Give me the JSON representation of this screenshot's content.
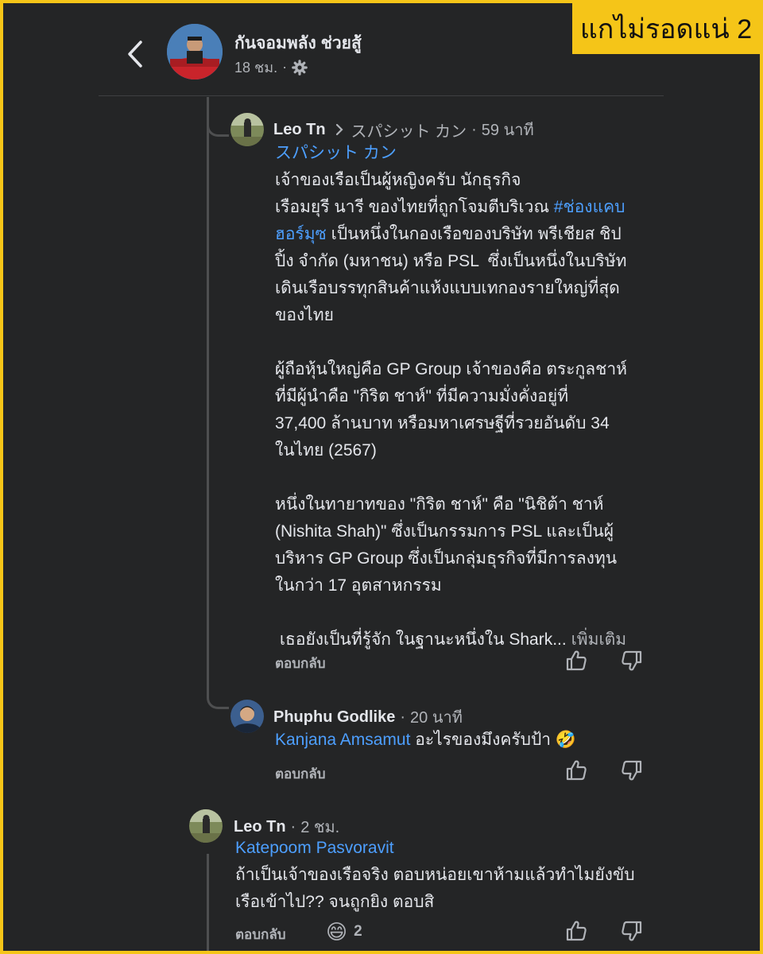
{
  "overlay_tag": "แกไม่รอดแน่ 2",
  "header": {
    "name": "กันจอมพลัง ช่วยสู้",
    "time": "18 ชม.",
    "separator": "·",
    "more": "···"
  },
  "comments": [
    {
      "author": "Leo Tn",
      "reply_to": "スパシット カン",
      "separator": "·",
      "time": "59 นาที",
      "mention": "スパシット カン",
      "body_pre": "เจ้าของเรือเป็นผู้หญิงครับ นักธุรกิจ\nเรือมยุรี นารี ของไทยที่ถูกโจมตีบริเวณ ",
      "hashtag": "#ช่องแคบ\nฮอร์มุซ",
      "body_post": " เป็นหนึ่งในกองเรือของบริษัท พรีเชียส ชิป\nปิ้ง จำกัด (มหาชน) หรือ PSL  ซึ่งเป็นหนึ่งในบริษัท\nเดินเรือบรรทุกสินค้าแห้งแบบเทกองรายใหญ่ที่สุด\nของไทย\n\nผู้ถือหุ้นใหญ่คือ GP Group เจ้าของคือ ตระกูลชาห์\nที่มีผู้นำคือ \"กิริต ชาห์\" ที่มีความมั่งคั่งอยู่ที่\n37,400 ล้านบาท หรือมหาเศรษฐีที่รวยอันดับ 34\nในไทย (2567)\n\nหนึ่งในทายาทของ \"กิริต ชาห์\" คือ \"นิชิต้า ชาห์\n(Nishita Shah)\" ซึ่งเป็นกรรมการ PSL และเป็นผู้\nบริหาร GP Group ซึ่งเป็นกลุ่มธุรกิจที่มีการลงทุน\nในกว่า 17 อุตสาหกรรม\n\n เธอยังเป็นที่รู้จัก ในฐานะหนึ่งใน Shark... ",
      "see_more": "เพิ่มเติม",
      "reply_label": "ตอบกลับ"
    },
    {
      "author": "Phuphu Godlike",
      "separator": "·",
      "time": "20 นาที",
      "mention": "Kanjana Amsamut",
      "body": " อะไรของมึงครับป้า 🤣",
      "reply_label": "ตอบกลับ"
    },
    {
      "author": "Leo Tn",
      "separator": "·",
      "time": "2 ชม.",
      "mention": "Katepoom Pasvoravit",
      "body": "ถ้าเป็นเจ้าของเรือจริง ตอบหน่อยเขาห้ามแล้วทำไมยังขับ\nเรือเข้าไป?? จนถูกยิง ตอบสิ",
      "reply_label": "ตอบกลับ",
      "reaction_emoji": "😄",
      "reaction_count": "2"
    }
  ],
  "colors": {
    "background": "#242526",
    "text": "#e4e6eb",
    "muted": "#b0b3b8",
    "link": "#4d9fff",
    "tag": "#f5c518"
  }
}
